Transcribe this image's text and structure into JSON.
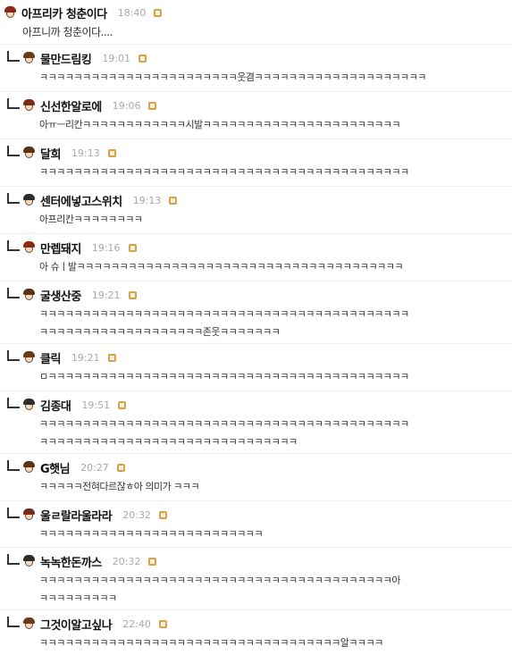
{
  "posts": [
    {
      "nick": "아프리카 청춘이다",
      "time": "18:40",
      "lines": [
        "아프니까 청춘이다...."
      ],
      "reply": false
    },
    {
      "nick": "물만드림킹",
      "time": "19:01",
      "lines": [
        "ㅋㅋㅋㅋㅋㅋㅋㅋㅋㅋㅋㅋㅋㅋㅋㅋㅋㅋㅋㅋㅋㅋㅋ웃겸ㅋㅋㅋㅋㅋㅋㅋㅋㅋㅋㅋㅋㅋㅋㅋㅋㅋㅋㅋㅋ"
      ],
      "reply": true
    },
    {
      "nick": "신선한알로에",
      "time": "19:06",
      "lines": [
        "아ㅠㅡ리칸ㅋㅋㅋㅋㅋㅋㅋㅋㅋㅋㅋㅋ시발ㅋㅋㅋㅋㅋㅋㅋㅋㅋㅋㅋㅋㅋㅋㅋㅋㅋㅋㅋㅋㅋㅋㅋ"
      ],
      "reply": true
    },
    {
      "nick": "달희",
      "time": "19:13",
      "lines": [
        "ㅋㅋㅋㅋㅋㅋㅋㅋㅋㅋㅋㅋㅋㅋㅋㅋㅋㅋㅋㅋㅋㅋㅋㅋㅋㅋㅋㅋㅋㅋㅋㅋㅋㅋㅋㅋㅋㅋㅋㅋㅋㅋㅋ"
      ],
      "reply": true
    },
    {
      "nick": "센터에넣고스위치",
      "time": "19:13",
      "lines": [
        "아프리칸ㅋㅋㅋㅋㅋㅋㅋㅋ"
      ],
      "reply": true
    },
    {
      "nick": "만렙돼지",
      "time": "19:16",
      "lines": [
        "아 슈ㅣ발ㅋㅋㅋㅋㅋㅋㅋㅋㅋㅋㅋㅋㅋㅋㅋㅋㅋㅋㅋㅋㅋㅋㅋㅋㅋㅋㅋㅋㅋㅋㅋㅋㅋㅋㅋㅋㅋㅋ"
      ],
      "reply": true
    },
    {
      "nick": "굴생산중",
      "time": "19:21",
      "lines": [
        "ㅋㅋㅋㅋㅋㅋㅋㅋㅋㅋㅋㅋㅋㅋㅋㅋㅋㅋㅋㅋㅋㅋㅋㅋㅋㅋㅋㅋㅋㅋㅋㅋㅋㅋㅋㅋㅋㅋㅋㅋㅋㅋㅋ",
        "ㅋㅋㅋㅋㅋㅋㅋㅋㅋㅋㅋㅋㅋㅋㅋㅋㅋㅋㅋ존웃ㅋㅋㅋㅋㅋㅋㅋ"
      ],
      "reply": true
    },
    {
      "nick": "클릭",
      "time": "19:21",
      "lines": [
        "ㅁㅋㅋㅋㅋㅋㅋㅋㅋㅋㅋㅋㅋㅋㅋㅋㅋㅋㅋㅋㅋㅋㅋㅋㅋㅋㅋㅋㅋㅋㅋㅋㅋㅋㅋㅋㅋㅋㅋㅋㅋㅋㅋ"
      ],
      "reply": true
    },
    {
      "nick": "김종대",
      "time": "19:51",
      "lines": [
        "ㅋㅋㅋㅋㅋㅋㅋㅋㅋㅋㅋㅋㅋㅋㅋㅋㅋㅋㅋㅋㅋㅋㅋㅋㅋㅋㅋㅋㅋㅋㅋㅋㅋㅋㅋㅋㅋㅋㅋㅋㅋㅋㅋ",
        "ㅋㅋㅋㅋㅋㅋㅋㅋㅋㅋㅋㅋㅋㅋㅋㅋㅋㅋㅋㅋㅋㅋㅋㅋㅋㅋㅋㅋㅋㅋ"
      ],
      "reply": true
    },
    {
      "nick": "G햇님",
      "time": "20:27",
      "lines": [
        "ㅋㅋㅋㅋㅋ전혀다르잖ㅎ아 의미가 ㅋㅋㅋ"
      ],
      "reply": true
    },
    {
      "nick": "울ㄹ랄라울라라",
      "time": "20:32",
      "lines": [
        "ㅋㅋㅋㅋㅋㅋㅋㅋㅋㅋㅋㅋㅋㅋㅋㅋㅋㅋㅋㅋㅋㅋㅋㅋㅋㅋ"
      ],
      "reply": true
    },
    {
      "nick": "녹녹한돈까스",
      "time": "20:32",
      "lines": [
        "ㅋㅋㅋㅋㅋㅋㅋㅋㅋㅋㅋㅋㅋㅋㅋㅋㅋㅋㅋㅋㅋㅋㅋㅋㅋㅋㅋㅋㅋㅋㅋㅋㅋㅋㅋㅋㅋㅋㅋㅋㅋ아",
        "ㅋㅋㅋㅋㅋㅋㅋㅋㅋ"
      ],
      "reply": true
    },
    {
      "nick": "그것이알고싶나",
      "time": "22:40",
      "lines": [
        "ㅋㅋㅋㅋㅋㅋㅋㅋㅋㅋㅋㅋㅋㅋㅋㅋㅋㅋㅋㅋㅋㅋㅋㅋㅋㅋㅋㅋㅋㅋㅋㅋㅋㅋㅋ알ㅋㅋㅋㅋ"
      ],
      "reply": true
    }
  ],
  "colors": {
    "badge": "#d9a24a",
    "time": "#a9a9a9",
    "nick": "#111111"
  }
}
